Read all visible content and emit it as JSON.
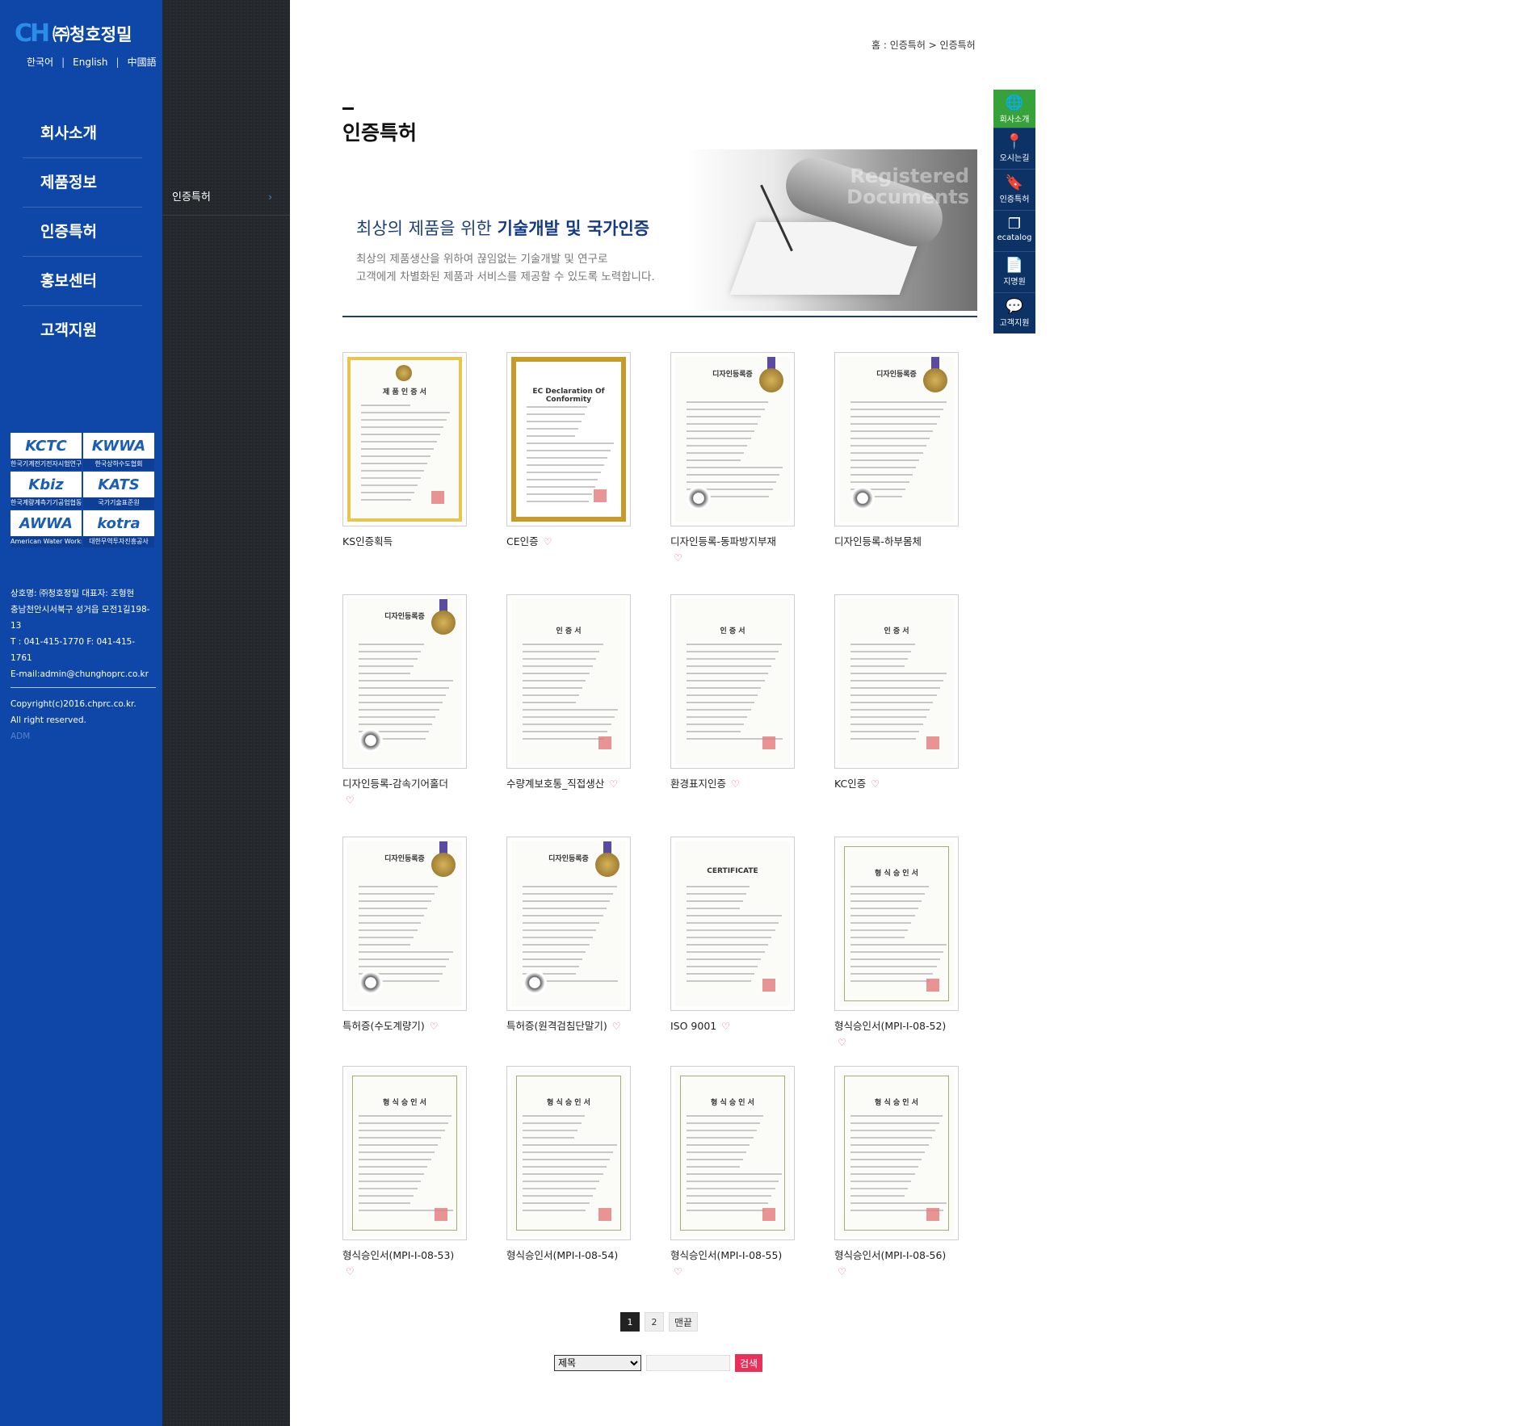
{
  "brand": {
    "logo_mark": "CH",
    "name": "㈜청호정밀"
  },
  "languages": [
    "한국어",
    "English",
    "中國語"
  ],
  "main_nav": [
    "회사소개",
    "제품정보",
    "인증특허",
    "홍보센터",
    "고객지원"
  ],
  "badges": [
    {
      "logo": "KCTC",
      "caption": "한국기계전기전자시험연구원"
    },
    {
      "logo": "KWWA",
      "caption": "한국상하수도협회"
    },
    {
      "logo": "Kbiz",
      "caption": "한국계량계측기기공업협동조합"
    },
    {
      "logo": "KATS",
      "caption": "국가기술표준원"
    },
    {
      "logo": "AWWA",
      "caption": "American Water Works Association"
    },
    {
      "logo": "kotra",
      "caption": "대한무역투자진흥공사"
    }
  ],
  "footer": {
    "line1": "상호명: ㈜청호정밀     대표자: 조형현",
    "line2": "충남천안시서북구 성거읍 모전1길198-13",
    "line3": "T : 041-415-1770    F: 041-415-1761",
    "line4": "E-mail:admin@chunghoprc.co.kr",
    "copyright1": "Copyright(c)2016.chprc.co.kr.",
    "copyright2": "All right reserved.",
    "adm": "ADM"
  },
  "sub_nav": {
    "label": "인증특허",
    "chevron": "›"
  },
  "breadcrumb": "홈 : 인증특허 > 인증특허",
  "page_title": "인증특허",
  "hero": {
    "headline_plain": "최상의 제품을 위한 ",
    "headline_bold1": "기술개발",
    "headline_mid": " 및 ",
    "headline_bold2": "국가인증",
    "desc1": "최상의 제품생산을 위하여 끊임없는 기술개발 및 연구로",
    "desc2": "고객에게 차별화된 제품과 서비스를 제공할 수 있도록 노력합니다.",
    "watermark1": "Registered",
    "watermark2": "Documents"
  },
  "quick_menu": [
    {
      "label": "회사소개",
      "icon": "globe-icon",
      "glyph": "🌐"
    },
    {
      "label": "오시는길",
      "icon": "location-pin-icon",
      "glyph": "📍"
    },
    {
      "label": "인증특허",
      "icon": "bookmark-icon",
      "glyph": "🔖"
    },
    {
      "label": "ecatalog",
      "icon": "catalog-icon",
      "glyph": "❐"
    },
    {
      "label": "지명원",
      "icon": "document-icon",
      "glyph": "📄"
    },
    {
      "label": "고객지원",
      "icon": "speech-bubble-icon",
      "glyph": "💬"
    }
  ],
  "certificates": [
    {
      "caption": "KS인증획득",
      "heart": false,
      "style": "gold"
    },
    {
      "caption": "CE인증",
      "heart": true,
      "style": "goldframe"
    },
    {
      "caption": "디자인등록-동파방지부재",
      "heart": true,
      "wrap": true,
      "style": "design"
    },
    {
      "caption": "디자인등록-하부몸체",
      "heart": false,
      "style": "design"
    },
    {
      "caption": "디자인등록-감속기어홀더",
      "heart": true,
      "wrap": true,
      "style": "design"
    },
    {
      "caption": "수량계보호통_직접생산",
      "heart": true,
      "style": "plain"
    },
    {
      "caption": "환경표지인증",
      "heart": true,
      "style": "plain"
    },
    {
      "caption": "KC인증",
      "heart": true,
      "style": "plain"
    },
    {
      "caption": "특허증(수도계량기)",
      "heart": true,
      "style": "design"
    },
    {
      "caption": "특허증(원격검침단말기)",
      "heart": true,
      "style": "design"
    },
    {
      "caption": "ISO 9001",
      "heart": true,
      "style": "iso"
    },
    {
      "caption": "형식승인서(MPI-I-08-52)",
      "heart": true,
      "wrap": true,
      "style": "greenframe"
    },
    {
      "caption": "형식승인서(MPI-I-08-53)",
      "heart": true,
      "wrap": true,
      "style": "greenframe"
    },
    {
      "caption": "형식승인서(MPI-I-08-54)",
      "heart": false,
      "style": "greenframe"
    },
    {
      "caption": "형식승인서(MPI-I-08-55)",
      "heart": true,
      "wrap": true,
      "style": "greenframe"
    },
    {
      "caption": "형식승인서(MPI-I-08-56)",
      "heart": true,
      "wrap": true,
      "style": "greenframe"
    }
  ],
  "doc_titles": {
    "gold": "제 품 인 증 서",
    "goldframe": "EC Declaration Of Conformity",
    "design": "디자인등록증",
    "plain": "인 증 서",
    "iso": "CERTIFICATE",
    "greenframe": "형 식 승 인 서"
  },
  "pagination": [
    "1",
    "2",
    "맨끝"
  ],
  "search": {
    "select_value": "제목",
    "button": "검색"
  },
  "heart_glyph": "♡"
}
